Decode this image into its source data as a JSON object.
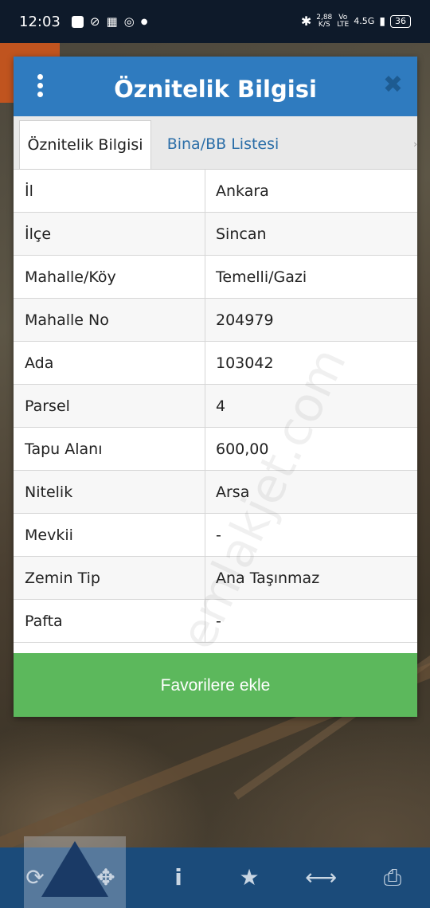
{
  "status_bar": {
    "time": "12:03",
    "net_speed_value": "2,88",
    "net_speed_unit": "K/S",
    "volte_top": "Vo",
    "volte_bottom": "LTE",
    "network": "4.5G",
    "battery": "36"
  },
  "dialog": {
    "title": "Öznitelik Bilgisi",
    "menu_icon": "kebab-menu-icon",
    "close_icon": "close-icon",
    "tabs": [
      {
        "label": "Öznitelik Bilgisi",
        "active": true
      },
      {
        "label": "Bina/BB Listesi",
        "active": false
      }
    ],
    "rows": [
      {
        "key": "İl",
        "value": "Ankara"
      },
      {
        "key": "İlçe",
        "value": "Sincan"
      },
      {
        "key": "Mahalle/Köy",
        "value": "Temelli/Gazi"
      },
      {
        "key": "Mahalle No",
        "value": "204979"
      },
      {
        "key": "Ada",
        "value": "103042"
      },
      {
        "key": "Parsel",
        "value": "4"
      },
      {
        "key": "Tapu Alanı",
        "value": "600,00"
      },
      {
        "key": "Nitelik",
        "value": "Arsa"
      },
      {
        "key": "Mevkii",
        "value": "-"
      },
      {
        "key": "Zemin Tip",
        "value": "Ana Taşınmaz"
      },
      {
        "key": "Pafta",
        "value": "-"
      }
    ],
    "favorite_button": "Favorilere ekle",
    "watermark": "emlakjet.com"
  },
  "toolbar": {
    "icons": [
      "refresh-icon",
      "move-icon",
      "info-icon",
      "star-icon",
      "measure-icon",
      "print-icon"
    ]
  },
  "colors": {
    "header": "#2f7bbf",
    "button": "#5cb85c",
    "toolbar": "#1b4b7a",
    "status_bar": "#0e1a2a"
  }
}
